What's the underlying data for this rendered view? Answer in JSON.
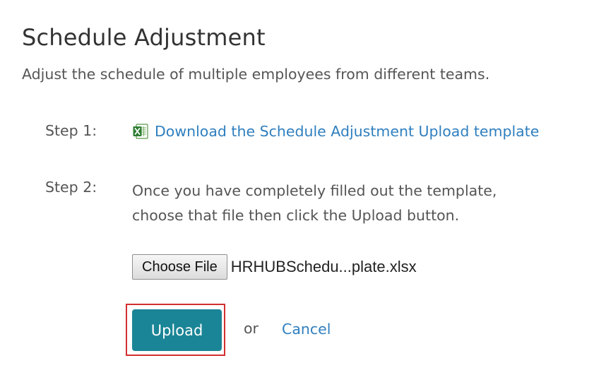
{
  "header": {
    "title": "Schedule Adjustment",
    "subtitle": "Adjust the schedule of multiple employees from different teams."
  },
  "step1": {
    "label": "Step 1:",
    "link_text": "Download the Schedule Adjustment Upload template",
    "icon": "excel-file-icon"
  },
  "step2": {
    "label": "Step 2:",
    "instruction_line1": "Once you have completely filled out the template,",
    "instruction_line2": "choose that file then click the Upload button.",
    "choose_file_label": "Choose File",
    "selected_file_name": "HRHUBSchedu...plate.xlsx"
  },
  "actions": {
    "upload_label": "Upload",
    "or_text": "or",
    "cancel_label": "Cancel"
  },
  "colors": {
    "link": "#2f7fbf",
    "upload_button": "#1a8596",
    "highlight": "#d32f2f",
    "text": "#555555"
  }
}
